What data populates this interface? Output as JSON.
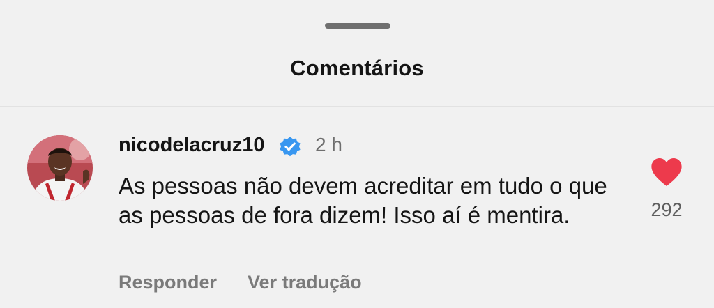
{
  "sheet": {
    "title": "Comentários"
  },
  "comment": {
    "username": "nicodelacruz10",
    "time": "2 h",
    "text": "As pessoas não devem acreditar em tudo o que as pessoas de fora dizem! Isso aí é mentira.",
    "likes": "292",
    "reply_label": "Responder",
    "translate_label": "Ver tradução",
    "verified_icon": "verified-badge-icon",
    "like_icon": "heart-icon",
    "liked": true
  },
  "colors": {
    "verified": "#3897f0",
    "heart": "#ed3a4c",
    "background": "#f1f1f1"
  }
}
